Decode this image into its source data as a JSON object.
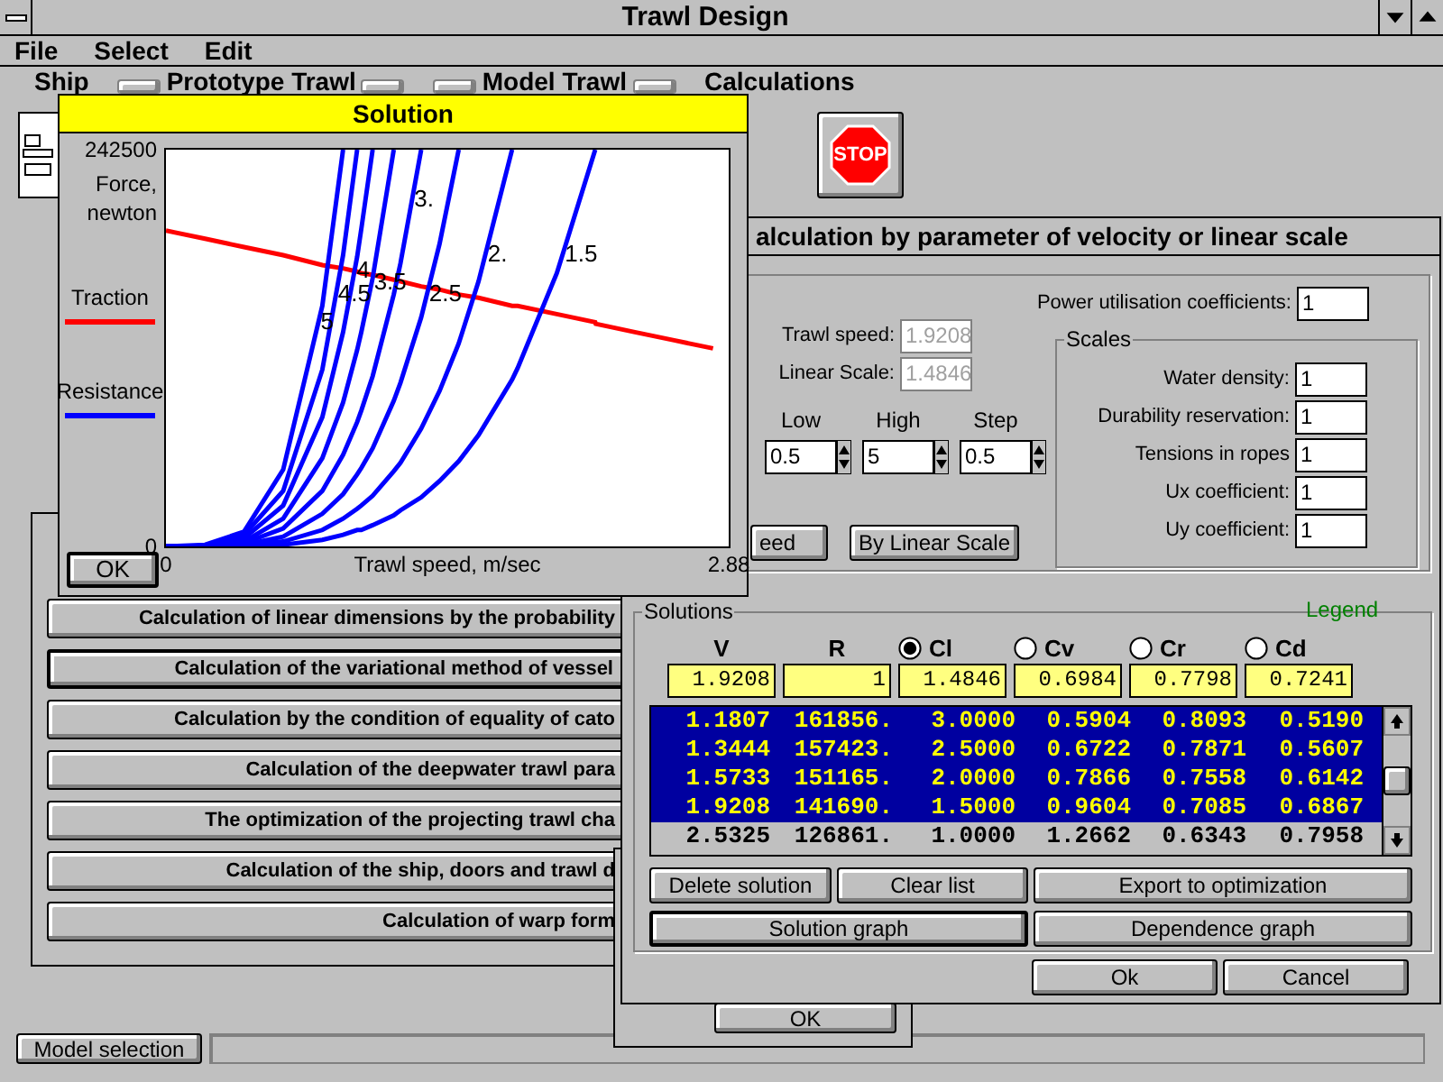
{
  "window": {
    "title": "Trawl Design"
  },
  "menu": [
    "File",
    "Select",
    "Edit"
  ],
  "toolbar": {
    "groups": [
      {
        "label": "Ship",
        "kind": "plain"
      },
      {
        "label": "Prototype Trawl",
        "kind": "bracketed"
      },
      {
        "label": "Model Trawl",
        "kind": "bracketed"
      },
      {
        "label": "Calculations",
        "kind": "plain"
      }
    ],
    "stop_button": "STOP"
  },
  "calculations": [
    {
      "label": "Calculation of linear dimensions by the probability",
      "default": false
    },
    {
      "label": "Calculation of the variational method of vessel",
      "default": true
    },
    {
      "label": "Calculation by the condition of equality of cato",
      "default": false
    },
    {
      "label": "Calculation of the deepwater trawl para",
      "default": false
    },
    {
      "label": "The optimization of the projecting trawl cha",
      "default": false
    },
    {
      "label": "Calculation of the ship, doors and trawl d",
      "default": false
    },
    {
      "label": "Calculation of warp form",
      "default": false
    }
  ],
  "model_selection_button": "Model selection",
  "back_dialog": {
    "ok_button": "OK"
  },
  "solution_window": {
    "title": "Solution",
    "ok_button": "OK",
    "resistance_label": "Resistance",
    "chart_data": {
      "type": "line",
      "xlabel": "Trawl speed, m/sec",
      "ylabel": "Force, newton",
      "xlim": [
        0,
        2.88
      ],
      "ylim": [
        0,
        242500
      ],
      "xticks": [
        {
          "value": 0,
          "label": "0"
        },
        {
          "value": 2.88,
          "label": "2.88"
        }
      ],
      "yticks": [
        {
          "value": 0,
          "label": "0"
        },
        {
          "value": 242500,
          "label": "242500"
        }
      ],
      "x": [
        0,
        0.2,
        0.4,
        0.6,
        0.8,
        0.906,
        0.978,
        1.0,
        1.058,
        1.166,
        1.2,
        1.306,
        1.4,
        1.498,
        1.6,
        1.771,
        1.8,
        2.0,
        2.197,
        2.2,
        2.4,
        2.6,
        2.8
      ],
      "series": [
        {
          "name": "Traction",
          "color": "#ff0000",
          "values": [
            193000,
            188000,
            183000,
            178000,
            172000,
            170000,
            168000,
            167000,
            166000,
            163000,
            162000,
            159000,
            157000,
            154000,
            152000,
            147000,
            147000,
            142000,
            137000,
            136000,
            131000,
            126000,
            121000
          ]
        },
        {
          "name": "5",
          "color": "#0000ff",
          "values": [
            0,
            1000,
            9000,
            47000,
            147000,
            242500,
            null,
            null,
            null,
            null,
            null,
            null,
            null,
            null,
            null,
            null,
            null,
            null,
            null,
            null,
            null,
            null,
            null
          ]
        },
        {
          "name": "4.5",
          "color": "#0000ff",
          "values": [
            0,
            0,
            7000,
            34000,
            108000,
            178000,
            242500,
            null,
            null,
            null,
            null,
            null,
            null,
            null,
            null,
            null,
            null,
            null,
            null,
            null,
            null,
            null,
            null
          ]
        },
        {
          "name": "4",
          "color": "#0000ff",
          "values": [
            0,
            0,
            5000,
            25000,
            79000,
            131000,
            177000,
            194000,
            242500,
            null,
            null,
            null,
            null,
            null,
            null,
            null,
            null,
            null,
            null,
            null,
            null,
            null,
            null
          ]
        },
        {
          "name": "3.5",
          "color": "#0000ff",
          "values": [
            0,
            0,
            3000,
            17000,
            54000,
            88000,
            120000,
            131000,
            164000,
            242500,
            null,
            null,
            null,
            null,
            null,
            null,
            null,
            null,
            null,
            null,
            null,
            null,
            null
          ]
        },
        {
          "name": "3.",
          "color": "#0000ff",
          "values": [
            0,
            0,
            2000,
            11000,
            34000,
            56000,
            76000,
            83000,
            104000,
            154000,
            173000,
            242500,
            null,
            null,
            null,
            null,
            null,
            null,
            null,
            null,
            null,
            null,
            null
          ]
        },
        {
          "name": "2.5",
          "color": "#0000ff",
          "values": [
            0,
            0,
            1000,
            6000,
            20000,
            32000,
            44000,
            48000,
            60000,
            89000,
            100000,
            140000,
            185000,
            242500,
            null,
            null,
            null,
            null,
            null,
            null,
            null,
            null,
            null
          ]
        },
        {
          "name": "2.",
          "color": "#0000ff",
          "values": [
            0,
            0,
            1000,
            3000,
            10000,
            17000,
            23000,
            25000,
            31000,
            46000,
            51000,
            72000,
            95000,
            124000,
            162000,
            242500,
            null,
            null,
            null,
            null,
            null,
            null,
            null
          ]
        },
        {
          "name": "1.5",
          "color": "#0000ff",
          "values": [
            0,
            0,
            0,
            1000,
            4000,
            7000,
            10000,
            10000,
            13000,
            19000,
            22000,
            30000,
            40000,
            52000,
            68000,
            102000,
            109000,
            167000,
            242500,
            null,
            null,
            null,
            null
          ]
        }
      ]
    }
  },
  "calc_dialog": {
    "title": "alculation by parameter of velocity or linear scale",
    "trawl_speed": {
      "label": "Trawl speed:",
      "value": "1.9208",
      "disabled": true
    },
    "linear_scale": {
      "label": "Linear Scale:",
      "value": "1.4846",
      "disabled": true
    },
    "range": [
      {
        "label": "Low",
        "value": "0.5"
      },
      {
        "label": "High",
        "value": "5"
      },
      {
        "label": "Step",
        "value": "0.5"
      }
    ],
    "buttons": [
      "eed",
      "By Linear Scale"
    ],
    "power": {
      "label": "Power utilisation coefficients:",
      "value": "1"
    },
    "scales": {
      "title": "Scales",
      "rows": [
        {
          "label": "Water density:",
          "value": "1"
        },
        {
          "label": "Durability reservation:",
          "value": "1"
        },
        {
          "label": "Tensions in ropes",
          "value": "1"
        },
        {
          "label": "Ux coefficient:",
          "value": "1"
        },
        {
          "label": "Uy coefficient:",
          "value": "1"
        }
      ]
    },
    "solutions": {
      "title": "Solutions",
      "legend": "Legend",
      "columns": [
        {
          "label": "V",
          "kind": "plain"
        },
        {
          "label": "R",
          "kind": "plain"
        },
        {
          "label": "Cl",
          "kind": "radio",
          "selected": true
        },
        {
          "label": "Cv",
          "kind": "radio",
          "selected": false
        },
        {
          "label": "Cr",
          "kind": "radio",
          "selected": false
        },
        {
          "label": "Cd",
          "kind": "radio",
          "selected": false
        }
      ],
      "current": [
        "1.9208",
        "1",
        "1.4846",
        "0.6984",
        "0.7798",
        "0.7241"
      ],
      "rows": [
        {
          "cells": [
            "1.1807",
            "161856.",
            "3.0000",
            "0.5904",
            "0.8093",
            "0.5190"
          ],
          "selected": true
        },
        {
          "cells": [
            "1.3444",
            "157423.",
            "2.5000",
            "0.6722",
            "0.7871",
            "0.5607"
          ],
          "selected": true
        },
        {
          "cells": [
            "1.5733",
            "151165.",
            "2.0000",
            "0.7866",
            "0.7558",
            "0.6142"
          ],
          "selected": true
        },
        {
          "cells": [
            "1.9208",
            "141690.",
            "1.5000",
            "0.9604",
            "0.7085",
            "0.6867"
          ],
          "selected": true
        },
        {
          "cells": [
            "2.5325",
            "126861.",
            "1.0000",
            "1.2662",
            "0.6343",
            "0.7958"
          ],
          "selected": false
        }
      ]
    },
    "action_rows": [
      [
        {
          "label": "Delete solution",
          "default": false
        },
        {
          "label": "Clear list",
          "default": false
        },
        {
          "label": "Export to optimization",
          "default": false
        }
      ],
      [
        {
          "label": "Solution graph",
          "default": true
        },
        {
          "label": "Dependence graph",
          "default": false
        }
      ]
    ],
    "footer_buttons": [
      "Ok",
      "Cancel"
    ]
  }
}
